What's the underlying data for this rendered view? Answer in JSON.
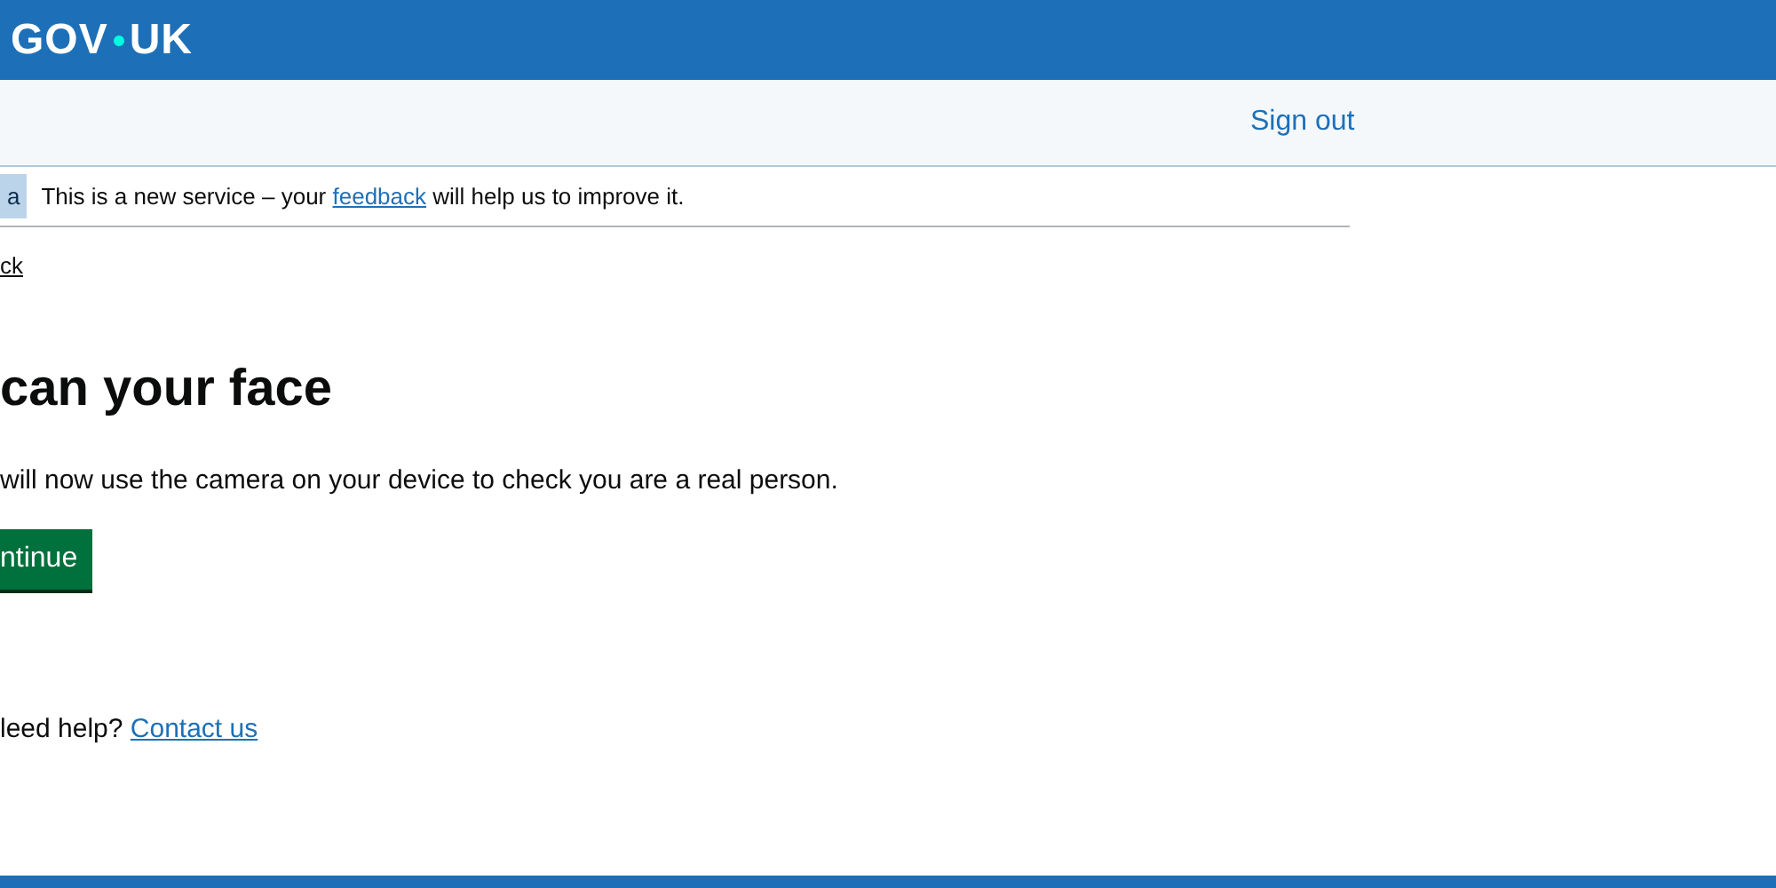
{
  "header": {
    "logo_left": "GOV",
    "logo_right": "UK"
  },
  "service_nav": {
    "sign_out": "Sign out"
  },
  "phase_banner": {
    "tag": "a",
    "text_before": "This is a new service – your",
    "link": "feedback",
    "text_after": "will help us to improve it."
  },
  "back_link": "ck",
  "heading": "can your face",
  "body": "will now use the camera on your device to check you are a real person.",
  "button": "ntinue",
  "help": {
    "text": "leed help?",
    "link": "Contact us"
  }
}
